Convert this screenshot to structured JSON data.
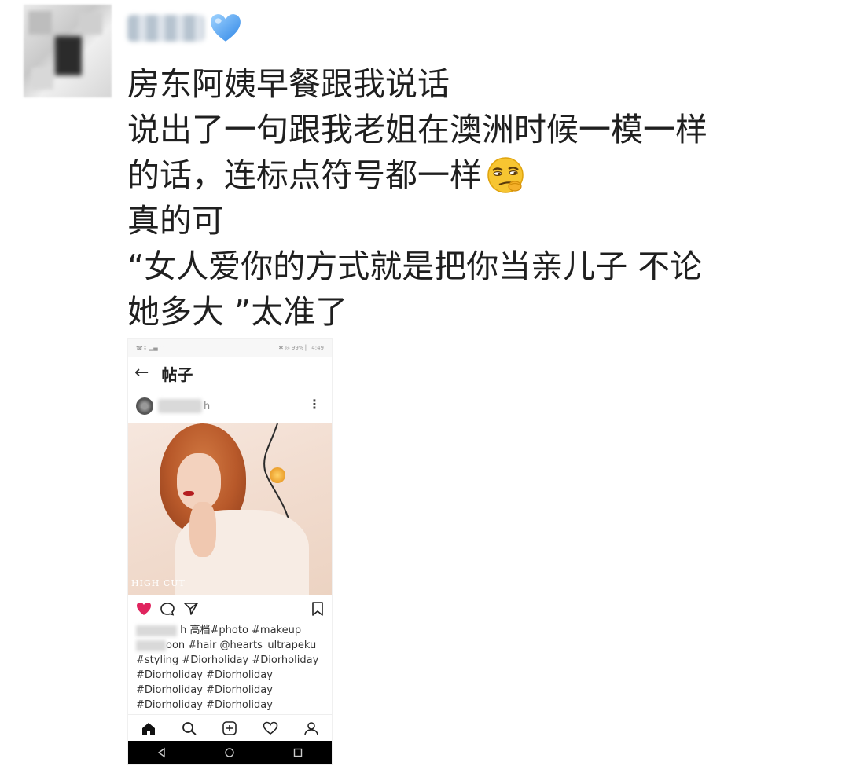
{
  "post": {
    "lines": [
      "房东阿姨早餐跟我说话",
      "说出了一句跟我老姐在澳洲时候一模一样",
      "的话，连标点符号都一样",
      "真的可",
      "“女人爱你的方式就是把你当亲儿子 不论",
      "她多大 ”太准了"
    ]
  },
  "screenshot": {
    "status_left": "☎↕ ▂▄ ▢",
    "status_right": "✱ ◎ 99% ▏ 4:49",
    "header": {
      "back_icon": "arrow-left-icon",
      "title": "帖子"
    },
    "user": {
      "name_suffix": "h",
      "more_icon": "more-vertical-icon"
    },
    "photo": {
      "watermark": "HIGH CUT"
    },
    "actions": {
      "liked": true,
      "accent": "#e0245e"
    },
    "caption": {
      "line1_rest": "h 高档#photo #makeup",
      "line2_rest": "oon #hair @hearts_ultrapeku",
      "line3": "#styling #Diorholiday #Diorholiday",
      "line4": "#Diorholiday #Diorholiday",
      "line5": "#Diorholiday #Diorholiday",
      "line6": "#Diorholiday #Diorholiday"
    },
    "bottom_nav": [
      "home-icon",
      "search-icon",
      "add-icon",
      "heart-icon",
      "profile-icon"
    ],
    "system_nav": [
      "back-triangle-icon",
      "home-circle-icon",
      "recents-square-icon"
    ]
  }
}
